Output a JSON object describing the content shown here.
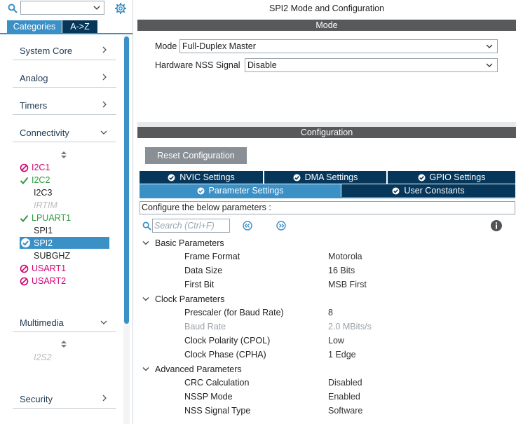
{
  "left_panel": {
    "search": {
      "value": ""
    },
    "tabs": [
      "Categories",
      "A->Z"
    ],
    "categories": [
      "System Core",
      "Analog",
      "Timers",
      "Connectivity",
      "Multimedia",
      "Security"
    ],
    "connectivity_items": [
      {
        "label": "I2C1",
        "state": "disabled"
      },
      {
        "label": "I2C2",
        "state": "enabled"
      },
      {
        "label": "I2C3",
        "state": "normal"
      },
      {
        "label": "IRTIM",
        "state": "unavailable"
      },
      {
        "label": "LPUART1",
        "state": "enabled"
      },
      {
        "label": "SPI1",
        "state": "normal"
      },
      {
        "label": "SPI2",
        "state": "selected"
      },
      {
        "label": "SUBGHZ",
        "state": "normal"
      },
      {
        "label": "USART1",
        "state": "disabled"
      },
      {
        "label": "USART2",
        "state": "disabled"
      }
    ],
    "multimedia_items": [
      {
        "label": "I2S2",
        "state": "unavailable"
      }
    ]
  },
  "main": {
    "title": "SPI2 Mode and Configuration",
    "mode_header": "Mode",
    "mode_label": "Mode",
    "mode_value": "Full-Duplex Master",
    "nss_label": "Hardware NSS Signal",
    "nss_value": "Disable",
    "config_header": "Configuration",
    "reset_button": "Reset Configuration",
    "tabs": {
      "nvic": "NVIC Settings",
      "dma": "DMA Settings",
      "gpio": "GPIO Settings",
      "parameter": "Parameter Settings",
      "user_constants": "User Constants"
    },
    "configure_text": "Configure the below parameters :",
    "search_placeholder": "Search (Ctrl+F)",
    "groups": [
      {
        "name": "Basic Parameters",
        "params": [
          {
            "name": "Frame Format",
            "value": "Motorola",
            "dim": false
          },
          {
            "name": "Data Size",
            "value": "16 Bits",
            "dim": false
          },
          {
            "name": "First Bit",
            "value": "MSB First",
            "dim": false
          }
        ]
      },
      {
        "name": "Clock Parameters",
        "params": [
          {
            "name": "Prescaler (for Baud Rate)",
            "value": "8",
            "dim": false
          },
          {
            "name": "Baud Rate",
            "value": "2.0 MBits/s",
            "dim": true
          },
          {
            "name": "Clock Polarity (CPOL)",
            "value": "Low",
            "dim": false
          },
          {
            "name": "Clock Phase (CPHA)",
            "value": "1 Edge",
            "dim": false
          }
        ]
      },
      {
        "name": "Advanced Parameters",
        "params": [
          {
            "name": "CRC Calculation",
            "value": "Disabled",
            "dim": false
          },
          {
            "name": "NSSP Mode",
            "value": "Enabled",
            "dim": false
          },
          {
            "name": "NSS Signal Type",
            "value": "Software",
            "dim": false
          }
        ]
      }
    ]
  },
  "colors": {
    "accent": "#3b90c6",
    "dark_navy": "#06375a",
    "header_gray": "#58595b",
    "enabled_green": "#2e9a3f",
    "disabled_pink": "#d4006e"
  }
}
